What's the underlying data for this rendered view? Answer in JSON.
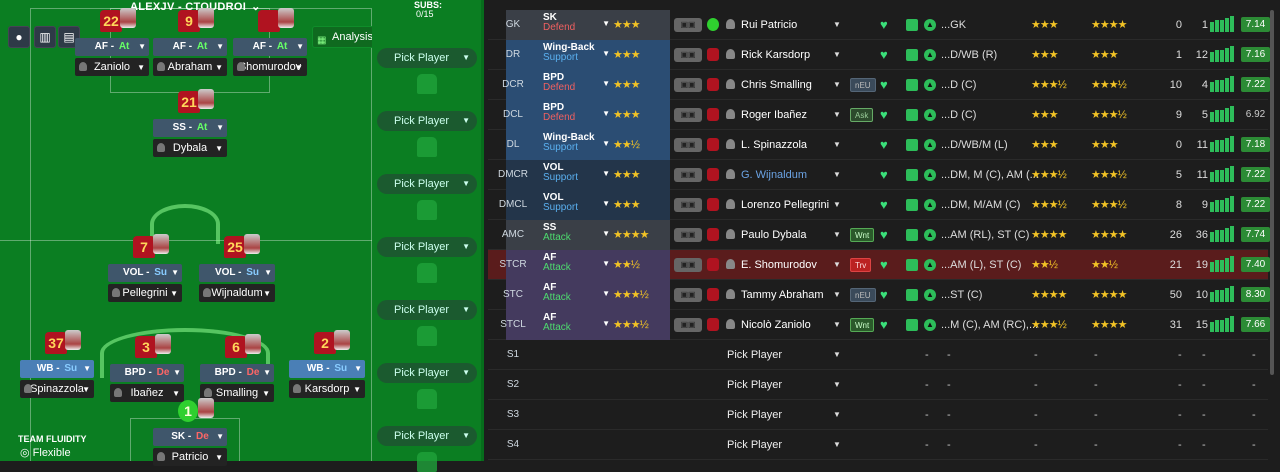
{
  "team_title": "ALEXJV - CTOUDROI",
  "analysis_label": "Analysis",
  "subs_label": "SUBS:",
  "subs_count": "0/15",
  "pick_label": "Pick Player",
  "fluidity_label": "TEAM FLUIDITY",
  "fluidity_value": "Flexible",
  "pitch": [
    {
      "num": "22",
      "role": "AF",
      "duty": "At",
      "name": "Zaniolo"
    },
    {
      "num": "9",
      "role": "AF",
      "duty": "At",
      "name": "Abraham"
    },
    {
      "num": "",
      "role": "AF",
      "duty": "At",
      "name": "Shomurodov"
    },
    {
      "num": "21",
      "role": "SS",
      "duty": "At",
      "name": "Dybala"
    },
    {
      "num": "7",
      "role": "VOL",
      "duty": "Su",
      "name": "Pellegrini"
    },
    {
      "num": "25",
      "role": "VOL",
      "duty": "Su",
      "name": "Wijnaldum"
    },
    {
      "num": "37",
      "role": "WB",
      "duty": "Su",
      "name": "Spinazzola"
    },
    {
      "num": "3",
      "role": "BPD",
      "duty": "De",
      "name": "Ibañez"
    },
    {
      "num": "6",
      "role": "BPD",
      "duty": "De",
      "name": "Smalling"
    },
    {
      "num": "2",
      "role": "WB",
      "duty": "Su",
      "name": "Karsdorp"
    },
    {
      "num": "1",
      "role": "SK",
      "duty": "De",
      "name": "Patricio"
    }
  ],
  "rows": [
    {
      "pos": "GK",
      "role": "SK",
      "duty": "Defend",
      "name": "Rui Patricio",
      "pp": "...GK",
      "apps": "0",
      "gls": "1",
      "rating": "7.14",
      "stars": "★★★",
      "ca": "★★★",
      "pa": "★★★★",
      "badge": ""
    },
    {
      "pos": "DR",
      "role": "Wing-Back",
      "duty": "Support",
      "name": "Rick Karsdorp",
      "pp": "...D/WB (R)",
      "apps": "1",
      "gls": "12",
      "rating": "7.16",
      "stars": "★★★",
      "ca": "★★★",
      "pa": "★★★",
      "badge": ""
    },
    {
      "pos": "DCR",
      "role": "BPD",
      "duty": "Defend",
      "name": "Chris Smalling",
      "pp": "...D (C)",
      "apps": "10",
      "gls": "4",
      "rating": "7.22",
      "stars": "★★★",
      "ca": "★★★½",
      "pa": "★★★½",
      "badge": "nEU"
    },
    {
      "pos": "DCL",
      "role": "BPD",
      "duty": "Defend",
      "name": "Roger Ibañez",
      "pp": "...D (C)",
      "apps": "9",
      "gls": "5",
      "rating": "6.92",
      "stars": "★★★",
      "ca": "★★★",
      "pa": "★★★½",
      "badge": "Ask"
    },
    {
      "pos": "DL",
      "role": "Wing-Back",
      "duty": "Support",
      "name": "L. Spinazzola",
      "pp": "...D/WB/M (L)",
      "apps": "0",
      "gls": "11",
      "rating": "7.18",
      "stars": "★★½",
      "ca": "★★★",
      "pa": "★★★",
      "badge": ""
    },
    {
      "pos": "DMCR",
      "role": "VOL",
      "duty": "Support",
      "name": "G. Wijnaldum",
      "pp": "...DM, M (C), AM (...",
      "apps": "5",
      "gls": "11",
      "rating": "7.22",
      "stars": "★★★",
      "ca": "★★★½",
      "pa": "★★★½",
      "badge": ""
    },
    {
      "pos": "DMCL",
      "role": "VOL",
      "duty": "Support",
      "name": "Lorenzo Pellegrini",
      "pp": "...DM, M/AM (C)",
      "apps": "8",
      "gls": "9",
      "rating": "7.22",
      "stars": "★★★",
      "ca": "★★★½",
      "pa": "★★★½",
      "badge": ""
    },
    {
      "pos": "AMC",
      "role": "SS",
      "duty": "Attack",
      "name": "Paulo Dybala",
      "pp": "...AM (RL), ST (C)",
      "apps": "26",
      "gls": "36",
      "rating": "7.74",
      "stars": "★★★★",
      "ca": "★★★★",
      "pa": "★★★★",
      "badge": "Wnt"
    },
    {
      "pos": "STCR",
      "role": "AF",
      "duty": "Attack",
      "name": "E. Shomurodov",
      "pp": "...AM (L), ST (C)",
      "apps": "21",
      "gls": "19",
      "rating": "7.40",
      "stars": "★★½",
      "ca": "★★½",
      "pa": "★★½",
      "badge": "Trv"
    },
    {
      "pos": "STC",
      "role": "AF",
      "duty": "Attack",
      "name": "Tammy Abraham",
      "pp": "...ST (C)",
      "apps": "50",
      "gls": "10",
      "rating": "8.30",
      "stars": "★★★½",
      "ca": "★★★★",
      "pa": "★★★★",
      "badge": "nEU"
    },
    {
      "pos": "STCL",
      "role": "AF",
      "duty": "Attack",
      "name": "Nicolò Zaniolo",
      "pp": "...M (C), AM (RC),...",
      "apps": "31",
      "gls": "15",
      "rating": "7.66",
      "stars": "★★★½",
      "ca": "★★★½",
      "pa": "★★★★",
      "badge": "Wnt"
    }
  ],
  "sub_rows": [
    {
      "pos": "S1"
    },
    {
      "pos": "S2"
    },
    {
      "pos": "S3"
    },
    {
      "pos": "S4"
    }
  ],
  "dash": "-"
}
